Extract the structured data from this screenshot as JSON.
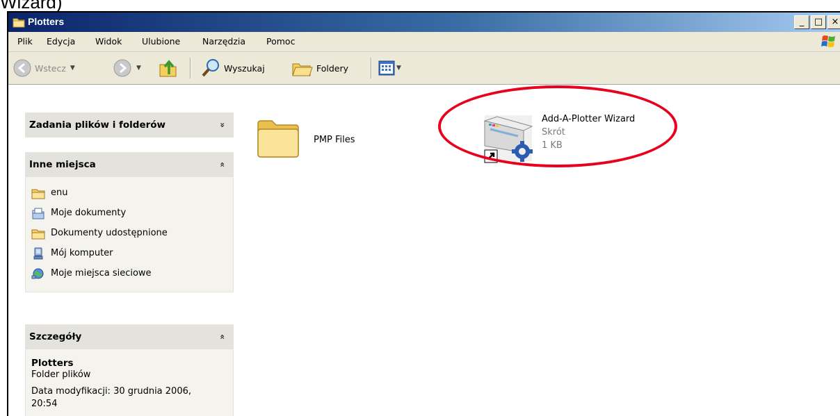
{
  "caption": "Wizard)",
  "window": {
    "title": "Plotters",
    "buttons": {
      "minimize": "_",
      "maximize": "□",
      "close": "×"
    }
  },
  "menu": [
    "Plik",
    "Edycja",
    "Widok",
    "Ulubione",
    "Narzędzia",
    "Pomoc"
  ],
  "toolbar": {
    "back": "Wstecz",
    "search": "Wyszukaj",
    "folders": "Foldery"
  },
  "taskpane": {
    "file_tasks": {
      "title": "Zadania plików i folderów",
      "chevron": "»"
    },
    "other_places": {
      "title": "Inne miejsca",
      "chevron": "«",
      "items": [
        {
          "label": "enu",
          "icon": "folder-icon"
        },
        {
          "label": "Moje dokumenty",
          "icon": "my-documents-icon"
        },
        {
          "label": "Dokumenty udostępnione",
          "icon": "folder-icon"
        },
        {
          "label": "Mój komputer",
          "icon": "my-computer-icon"
        },
        {
          "label": "Moje miejsca sieciowe",
          "icon": "network-places-icon"
        }
      ]
    },
    "details": {
      "title": "Szczegóły",
      "chevron": "«",
      "name": "Plotters",
      "type": "Folder plików",
      "modified": "Data modyfikacji: 30 grudnia 2006, 20:54"
    }
  },
  "files": [
    {
      "name": "PMP Files",
      "icon": "folder-icon"
    },
    {
      "name": "Add-A-Plotter Wizard",
      "type": "Skrót",
      "size": "1 KB",
      "icon": "plotter-shortcut-icon"
    }
  ],
  "colors": {
    "highlight": "#e8001c",
    "titlebar": "#0a246a",
    "chrome": "#ece9d8"
  }
}
